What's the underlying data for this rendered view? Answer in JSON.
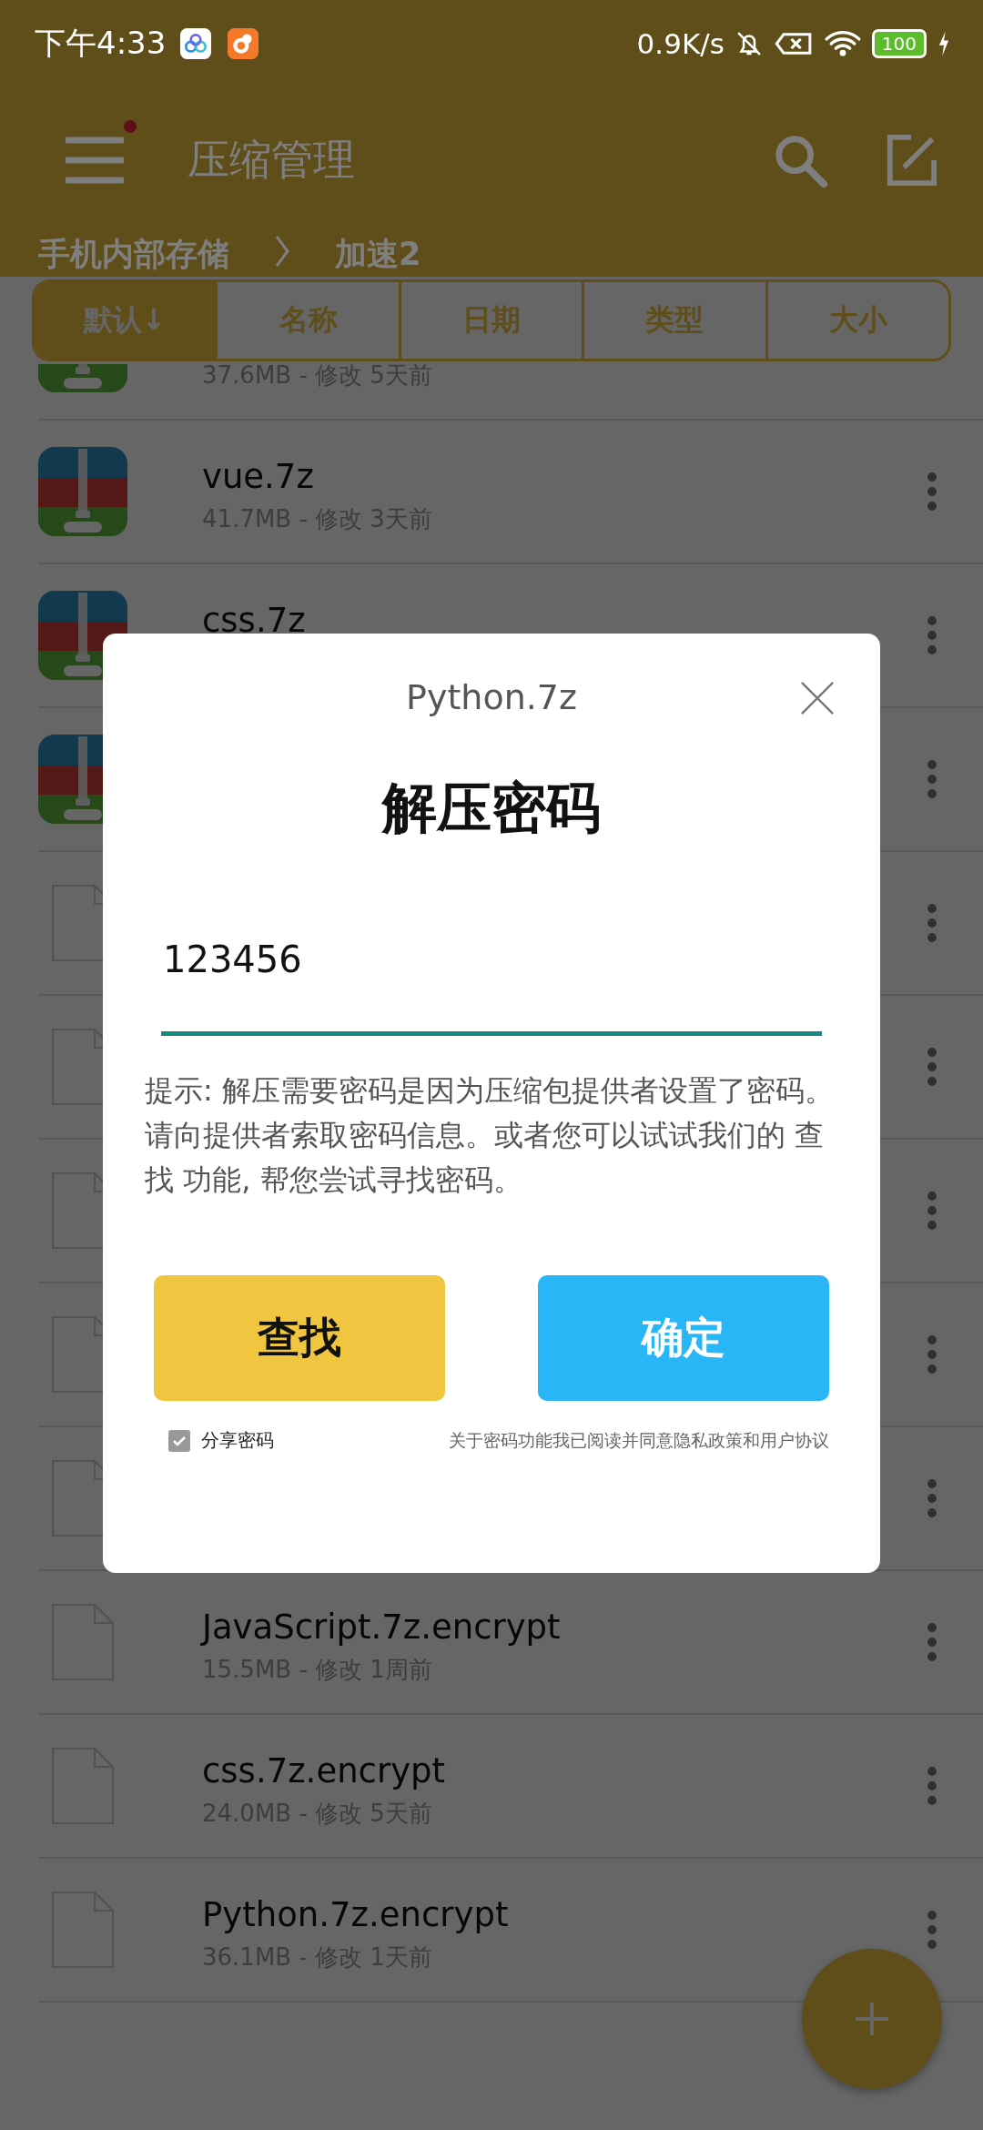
{
  "status_bar": {
    "time": "下午4:33",
    "net_speed": "0.9K/s",
    "battery": "100"
  },
  "app_bar": {
    "title": "压缩管理",
    "menu_badge": true
  },
  "breadcrumb": [
    {
      "label": "手机内部存储"
    },
    {
      "label": "加速2"
    }
  ],
  "sort_tabs": [
    {
      "label": "默认↓",
      "selected": true
    },
    {
      "label": "名称",
      "selected": false
    },
    {
      "label": "日期",
      "selected": false
    },
    {
      "label": "类型",
      "selected": false
    },
    {
      "label": "大小",
      "selected": false
    }
  ],
  "files": [
    {
      "kind": "zip",
      "meta": "37.6MB - 修改 5天前"
    },
    {
      "kind": "zip",
      "name": "vue.7z",
      "meta": "41.7MB - 修改 3天前"
    },
    {
      "kind": "zip",
      "name": "css.7z"
    },
    {
      "kind": "zip"
    },
    {
      "kind": "file"
    },
    {
      "kind": "file"
    },
    {
      "kind": "file"
    },
    {
      "kind": "file"
    },
    {
      "kind": "file"
    },
    {
      "kind": "file",
      "name": "JavaScript.7z.encrypt",
      "meta": "15.5MB - 修改 1周前"
    },
    {
      "kind": "file",
      "name": "css.7z.encrypt",
      "meta": "24.0MB - 修改 5天前"
    },
    {
      "kind": "file",
      "name": "Python.7z.encrypt",
      "meta": "36.1MB - 修改 1天前"
    }
  ],
  "dialog": {
    "file_name": "Python.7z",
    "title": "解压密码",
    "password": {
      "value": "123456"
    },
    "hint": "提示: 解压需要密码是因为压缩包提供者设置了密码。请向提供者索取密码信息。或者您可以试试我们的 查找 功能, 帮您尝试寻找密码。",
    "buttons": [
      {
        "label": "查找",
        "kind": "find"
      },
      {
        "label": "确定",
        "kind": "confirm"
      }
    ],
    "share_password": {
      "label": "分享密码",
      "checked": true
    },
    "agreement": "关于密码功能我已阅读并同意隐私政策和用户协议"
  }
}
